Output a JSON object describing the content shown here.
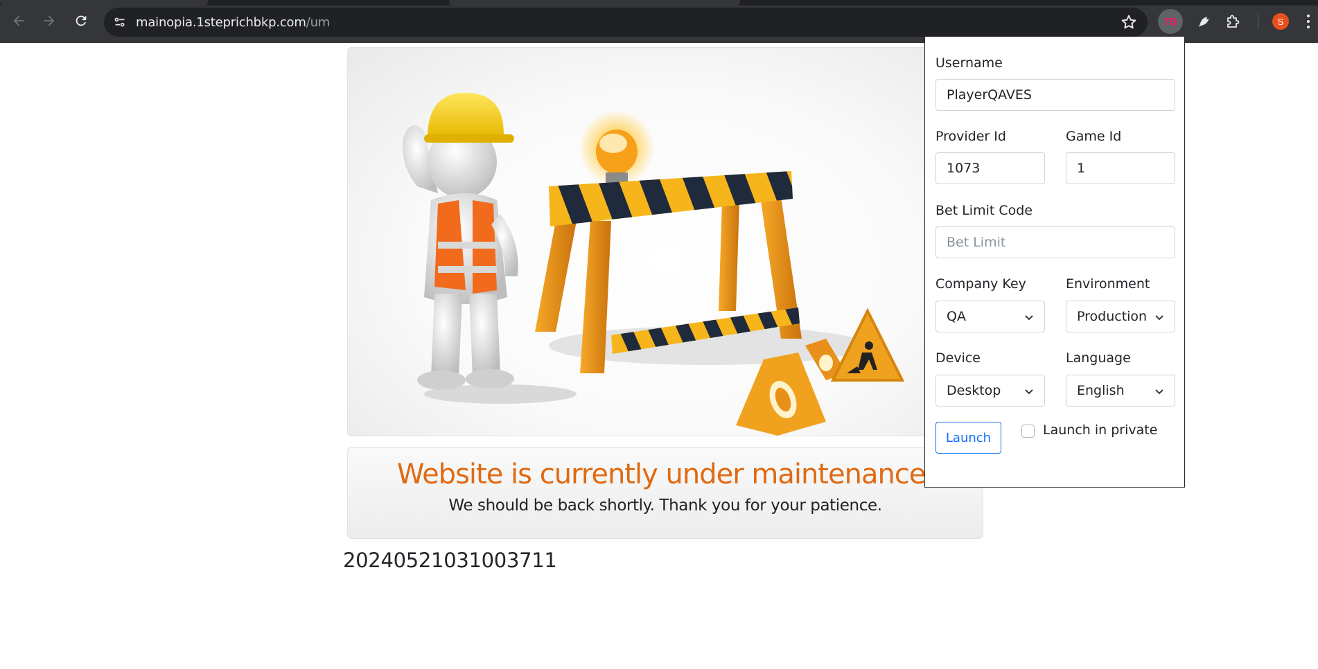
{
  "browser": {
    "url_host": "mainopia.1steprichbkp.com",
    "url_path": "/um",
    "extension_badge": "TB",
    "profile_initial": "S",
    "icons": [
      "back-icon",
      "forward-icon",
      "reload-icon",
      "site-info-icon",
      "bookmark-star-icon",
      "feather-extension-icon",
      "puzzle-extension-icon",
      "menu-dots-icon"
    ]
  },
  "page": {
    "maintenance_title": "Website is currently under maintenance.",
    "maintenance_subtitle": "We should be back shortly. Thank you for your patience.",
    "timestamp": "20240521031003711"
  },
  "popup": {
    "username_label": "Username",
    "username_value": "PlayerQAVES",
    "provider_id_label": "Provider Id",
    "provider_id_value": "1073",
    "game_id_label": "Game Id",
    "game_id_value": "1",
    "bet_limit_label": "Bet Limit Code",
    "bet_limit_placeholder": "Bet Limit",
    "company_key_label": "Company Key",
    "company_key_value": "QA",
    "environment_label": "Environment",
    "environment_value": "Production",
    "device_label": "Device",
    "device_value": "Desktop",
    "language_label": "Language",
    "language_value": "English",
    "launch_label": "Launch",
    "launch_private_label": "Launch in private"
  },
  "colors": {
    "chrome_bg": "#35363a",
    "omnibox_bg": "#202124",
    "accent_blue": "#0d6efd",
    "maintenance_orange": "#e06a12",
    "avatar": "#e8501d"
  }
}
